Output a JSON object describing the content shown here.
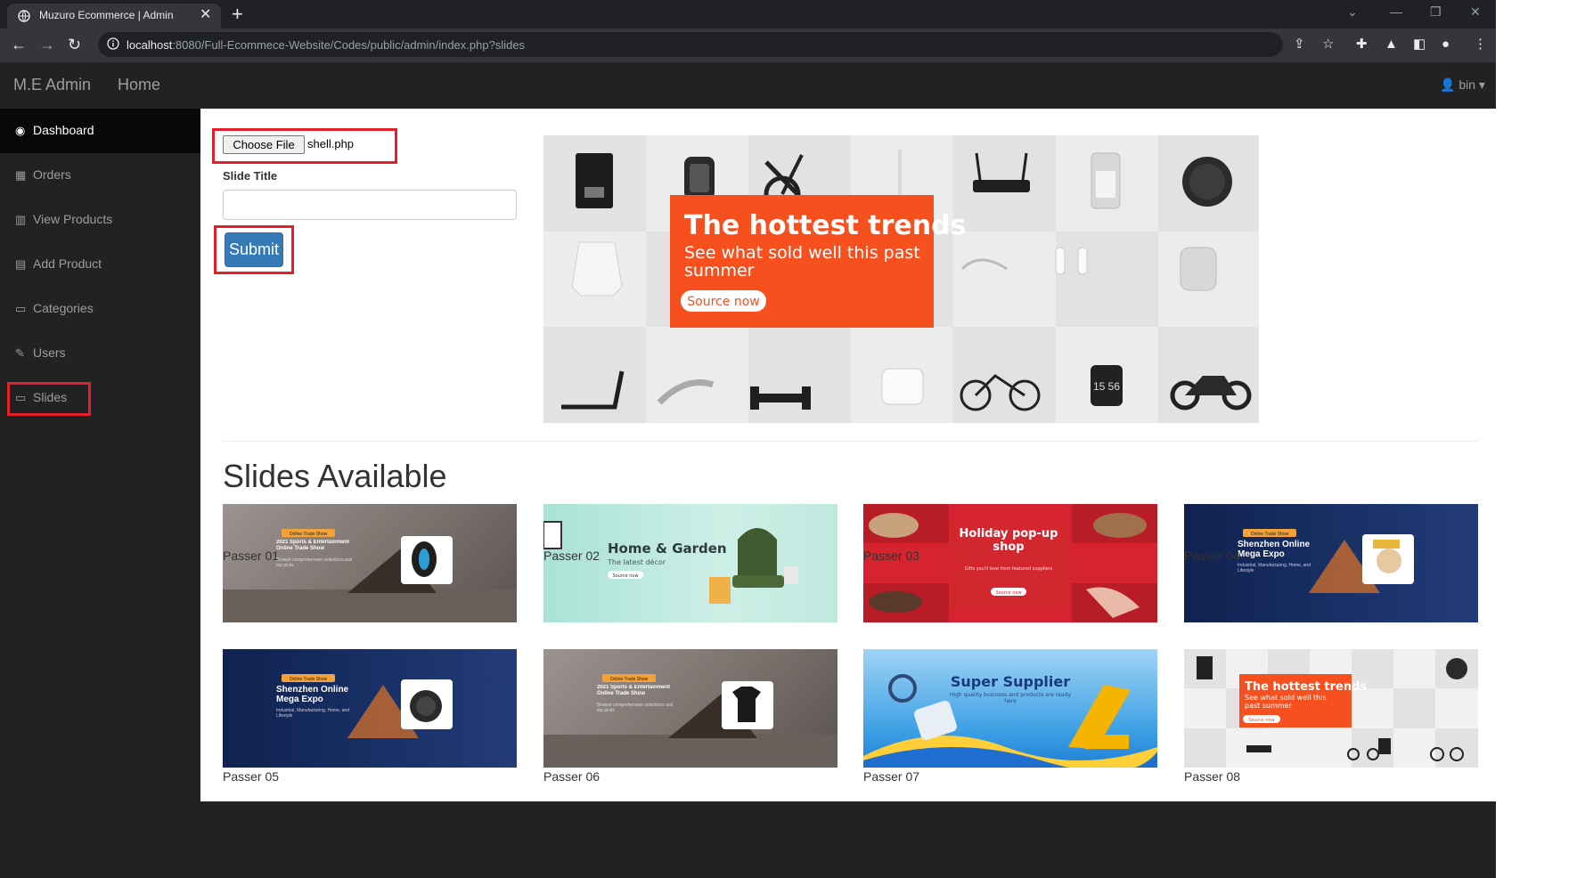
{
  "browser": {
    "tab_title": "Muzuro Ecommerce | Admin",
    "tab_close": "✕",
    "new_tab": "+",
    "url_host": "localhost",
    "url_path": ":8080/Full-Ecommece-Website/Codes/public/admin/index.php?slides"
  },
  "navbar": {
    "brand": "M.E Admin",
    "home": "Home",
    "user": "bin"
  },
  "sidebar": {
    "items": [
      {
        "label": "Dashboard",
        "icon": "dashboard-icon",
        "active": true
      },
      {
        "label": "Orders",
        "icon": "cubes-icon"
      },
      {
        "label": "View Products",
        "icon": "bar-chart-icon"
      },
      {
        "label": "Add Product",
        "icon": "table-icon"
      },
      {
        "label": "Categories",
        "icon": "desktop-icon"
      },
      {
        "label": "Users",
        "icon": "wrench-icon"
      },
      {
        "label": "Slides",
        "icon": "desktop-icon"
      }
    ]
  },
  "form": {
    "choose_file": "Choose File",
    "file_name": "shell.php",
    "slide_title_label": "Slide Title",
    "slide_title_value": "",
    "submit": "Submit"
  },
  "preview": {
    "headline": "The hottest trends",
    "subline": "See what sold well this past summer",
    "button": "Source now",
    "watch_time": "15 56"
  },
  "slides_heading": "Slides Available",
  "slides": [
    {
      "caption": "Passer 01",
      "badge": "Online Trade Show",
      "headline": "2021 Sports & Entertainment Online Trade Show",
      "sub": "Browse comprehensive selections and top picks"
    },
    {
      "caption": "Passer 02",
      "headline": "Home & Garden",
      "sub": "The latest décor",
      "button": "Source now"
    },
    {
      "caption": "Passer 03",
      "headline": "Holiday pop-up shop",
      "sub": "Gifts you'll love from featured suppliers",
      "button": "Source now"
    },
    {
      "caption": "Passer 04",
      "badge": "Online Trade Show",
      "headline": "Shenzhen Online Mega Expo",
      "sub": "Industrial, Manufacturing, Home, and Lifestyle"
    },
    {
      "caption": "Passer 05",
      "badge": "Online Trade Show",
      "headline": "Shenzhen Online Mega Expo",
      "sub": "Industrial, Manufacturing, Home, and Lifestyle"
    },
    {
      "caption": "Passer 06",
      "badge": "Online Trade Show",
      "headline": "2021 Sports & Entertainment Online Trade Show",
      "sub": "Browse comprehensive selections and top picks"
    },
    {
      "caption": "Passer 07",
      "headline": "Super Supplier",
      "sub": "High quality business and products are ready here"
    },
    {
      "caption": "Passer 08",
      "headline": "The hottest trends",
      "sub": "See what sold well this past summer",
      "button": "Source now"
    }
  ],
  "colors": {
    "highlight": "#e3202a",
    "primary_button": "#337ab7",
    "promo_orange": "#f5501e",
    "navbar_bg": "#222222"
  }
}
